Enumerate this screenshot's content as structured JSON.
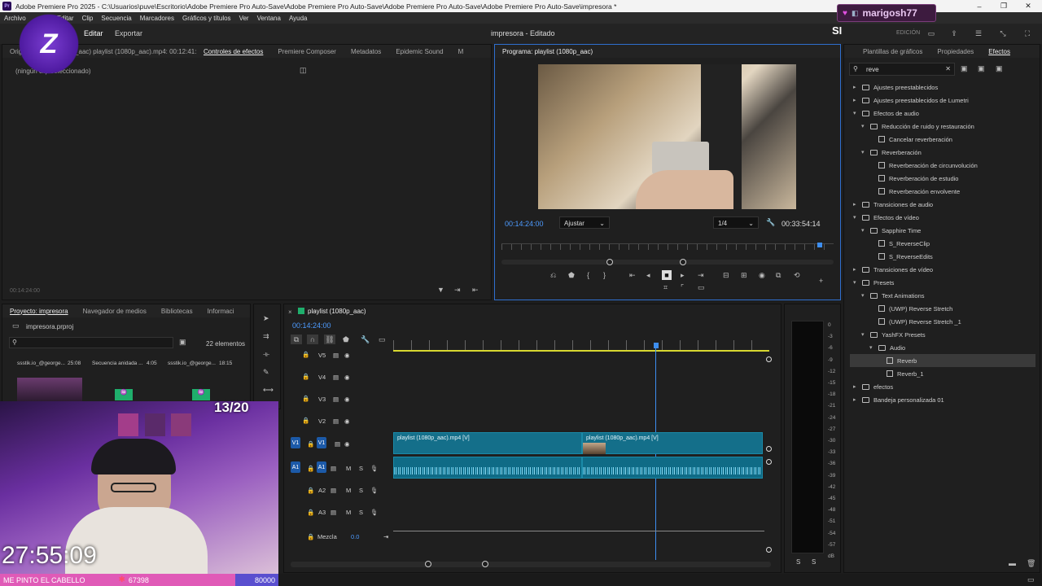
{
  "titlebar": {
    "logo": "Pr",
    "title": "Adobe Premiere Pro 2025 - C:\\Usuarios\\puve\\Escritorio\\Adobe Premiere Pro Auto-Save\\Adobe Premiere Pro Auto-Save\\Adobe Premiere Pro Auto-Save\\Adobe Premiere Pro Auto-Save\\impresora *"
  },
  "menu": [
    "Archivo",
    "Editar",
    "Clip",
    "Secuencia",
    "Marcadores",
    "Gráficos y títulos",
    "Ver",
    "Ventana",
    "Ayuda"
  ],
  "header": {
    "edit": "Editar",
    "export": "Exportar",
    "center": "impresora - Editado",
    "edition": "EDICIÓN"
  },
  "source": {
    "tabs": [
      "Origen: playlist (1080p_aac) playlist (1080p_aac).mp4: 00:12:41:27",
      "Controles de efectos",
      "Premiere Composer",
      "Metadatos",
      "Epidemic Sound",
      "M"
    ],
    "empty": "(ningún clip seleccionado)",
    "time": "00:14:24:00"
  },
  "program": {
    "tab": "Programa: playlist (1080p_aac)",
    "time": "00:14:24:00",
    "fit": "Ajustar",
    "resolution": "1/4",
    "duration": "00:33:54:14"
  },
  "effects": {
    "tabs": [
      "Plantillas de gráficos",
      "Propiedades",
      "Efectos"
    ],
    "search": "reve",
    "tree": [
      {
        "label": "Ajustes preestablecidos",
        "level": 0,
        "kind": "folder",
        "open": false
      },
      {
        "label": "Ajustes preestablecidos de Lumetri",
        "level": 0,
        "kind": "folder",
        "open": false
      },
      {
        "label": "Efectos de audio",
        "level": 0,
        "kind": "folder",
        "open": true
      },
      {
        "label": "Reducción de ruido y restauración",
        "level": 1,
        "kind": "folder",
        "open": true
      },
      {
        "label": "Cancelar reverberación",
        "level": 2,
        "kind": "fx"
      },
      {
        "label": "Reverberación",
        "level": 1,
        "kind": "folder",
        "open": true
      },
      {
        "label": "Reverberación de circunvolución",
        "level": 2,
        "kind": "fx"
      },
      {
        "label": "Reverberación de estudio",
        "level": 2,
        "kind": "fx"
      },
      {
        "label": "Reverberación envolvente",
        "level": 2,
        "kind": "fx"
      },
      {
        "label": "Transiciones de audio",
        "level": 0,
        "kind": "folder",
        "open": false
      },
      {
        "label": "Efectos de vídeo",
        "level": 0,
        "kind": "folder",
        "open": true
      },
      {
        "label": "Sapphire Time",
        "level": 1,
        "kind": "folder",
        "open": true
      },
      {
        "label": "S_ReverseClip",
        "level": 2,
        "kind": "fx"
      },
      {
        "label": "S_ReverseEdits",
        "level": 2,
        "kind": "fx"
      },
      {
        "label": "Transiciones de vídeo",
        "level": 0,
        "kind": "folder",
        "open": false
      },
      {
        "label": "Presets",
        "level": 0,
        "kind": "folder",
        "open": true
      },
      {
        "label": "Text Animations",
        "level": 1,
        "kind": "folder",
        "open": true
      },
      {
        "label": "(UWP) Reverse Stretch",
        "level": 2,
        "kind": "fx"
      },
      {
        "label": "(UWP) Reverse Stretch _1",
        "level": 2,
        "kind": "fx"
      },
      {
        "label": "YashFX Presets",
        "level": 1,
        "kind": "folder",
        "open": true
      },
      {
        "label": "Audio",
        "level": 2,
        "kind": "folder",
        "open": true
      },
      {
        "label": "Reverb",
        "level": 3,
        "kind": "fx",
        "selected": true
      },
      {
        "label": "Reverb_1",
        "level": 3,
        "kind": "fx"
      },
      {
        "label": "efectos",
        "level": 0,
        "kind": "folder",
        "open": false
      },
      {
        "label": "Bandeja personalizada 01",
        "level": 0,
        "kind": "folder",
        "open": false
      }
    ]
  },
  "project": {
    "tabs": [
      "Proyecto: impresora",
      "Navegador de medios",
      "Bibliotecas",
      "Informaci"
    ],
    "file": "impresora.prproj",
    "count": "22 elementos",
    "items": [
      "ssstik.io_@george...",
      "Secuencia anidada ...",
      "ssstik.io_@george..."
    ],
    "durations": [
      "25:08",
      "4:05",
      "18:15"
    ]
  },
  "timeline": {
    "tab": "playlist (1080p_aac)",
    "time": "00:14:24:00",
    "video_tracks": [
      "V5",
      "V4",
      "V3",
      "V2",
      "V1"
    ],
    "audio_tracks": [
      "A1",
      "A2",
      "A3"
    ],
    "mix_label": "Mezcla",
    "mix_value": "0.0",
    "clip1": "playlist (1080p_aac).mp4 [V]",
    "clip2": "playlist (1080p_aac).mp4 [V]"
  },
  "meter": {
    "scale": [
      "0",
      "-3",
      "-6",
      "-9",
      "-12",
      "-15",
      "-18",
      "-21",
      "-24",
      "-27",
      "-30",
      "-33",
      "-36",
      "-39",
      "-42",
      "-45",
      "-48",
      "-51",
      "-54",
      "-57",
      "dB"
    ],
    "bottom": [
      "S",
      "S"
    ]
  },
  "overlay": {
    "username": "marigosh77",
    "si": "SI",
    "counter": "13/20",
    "timer": "27:55:09",
    "banner": "ME PINTO EL CABELLO",
    "points": "67398",
    "goal": "80000"
  }
}
